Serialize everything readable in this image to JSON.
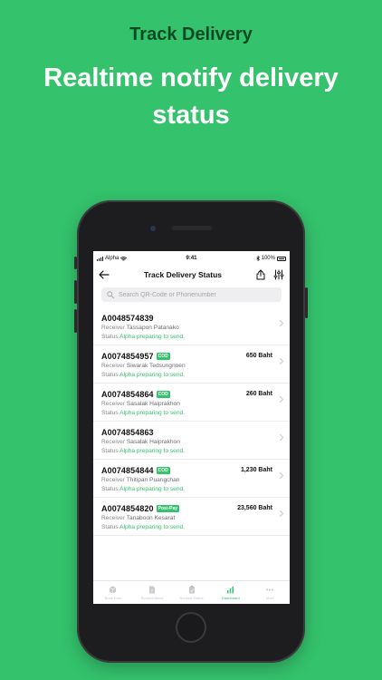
{
  "promo": {
    "subtitle": "Track Delivery",
    "title": "Realtime notify delivery status"
  },
  "statusbar": {
    "carrier": "Alpha",
    "time": "9:41",
    "battery": "100%"
  },
  "navbar": {
    "title": "Track Delivery Status"
  },
  "search": {
    "placeholder": "Search QR-Code or Phonenumber"
  },
  "labels": {
    "receiver": "Receiver",
    "status": "Status"
  },
  "deliveries": [
    {
      "id": "A0048574839",
      "tag": "",
      "amount": "",
      "receiver": "Tassapon Patanako",
      "status": "Alpha preparing to send."
    },
    {
      "id": "A0074854957",
      "tag": "COD",
      "amount": "650 Baht",
      "receiver": "Siwarak Tedsungnoen",
      "status": "Alpha preparing to send."
    },
    {
      "id": "A0074854864",
      "tag": "COD",
      "amount": "260 Baht",
      "receiver": "Sasalak Haiprakhon",
      "status": "Alpha preparing to send."
    },
    {
      "id": "A0074854863",
      "tag": "",
      "amount": "",
      "receiver": "Sasalak Haiprakhon",
      "status": "Alpha preparing to send."
    },
    {
      "id": "A0074854844",
      "tag": "COD",
      "amount": "1,230 Baht",
      "receiver": "Thitipan Puangchan",
      "status": "Alpha preparing to send."
    },
    {
      "id": "A0074854820",
      "tag": "Post-Pay",
      "amount": "23,560 Baht",
      "receiver": "Tanaboon Kesarat",
      "status": "Alpha preparing to send."
    }
  ],
  "tabbar": {
    "active": 3,
    "items": [
      {
        "label": "Book Now",
        "icon": "box-icon"
      },
      {
        "label": "Booked Items",
        "icon": "document-icon"
      },
      {
        "label": "Booked Status",
        "icon": "clipboard-icon"
      },
      {
        "label": "Dashboard",
        "icon": "bar-chart-icon"
      },
      {
        "label": "More",
        "icon": "more-icon"
      }
    ]
  },
  "colors": {
    "brand": "#34c26c",
    "subtitle": "#0c4a24"
  }
}
